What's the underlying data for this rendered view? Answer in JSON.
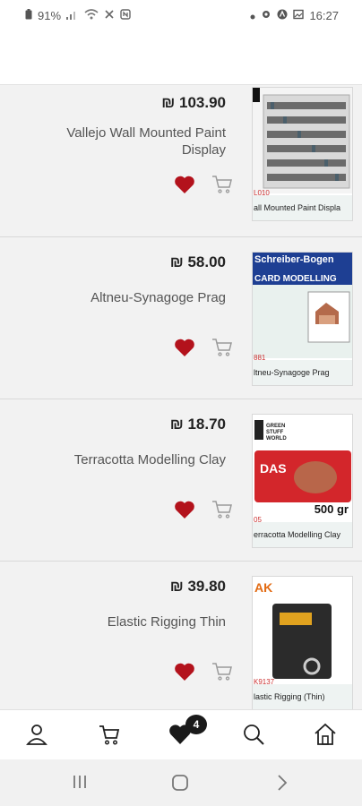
{
  "statusbar": {
    "battery": "91%",
    "time": "16:27"
  },
  "currency": "₪",
  "products": [
    {
      "price": "₪ 103.90",
      "name": "Vallejo Wall Mounted Paint Display",
      "image_code": "L010",
      "image_caption": "all Mounted Paint Displa"
    },
    {
      "price": "₪ 58.00",
      "name": "Altneu-Synagoge Prag",
      "image_title": "Schreiber-Bogen",
      "image_subtitle": "CARD MODELLING",
      "image_code": "881",
      "image_caption": "ltneu-Synagoge Prag"
    },
    {
      "price": "₪ 18.70",
      "name": "Terracotta Modelling Clay",
      "image_brand": "GREEN STUFF WORLD",
      "image_product": "DAS",
      "image_weight": "500 gr",
      "image_code": "05",
      "image_caption": "erracotta Modelling Clay"
    },
    {
      "price": "₪ 39.80",
      "name": "Elastic Rigging Thin",
      "image_brand": "AK",
      "image_code": "K9137",
      "image_caption": "lastic Rigging (Thin)"
    }
  ],
  "bottomnav": {
    "wishlist_count": "4"
  }
}
